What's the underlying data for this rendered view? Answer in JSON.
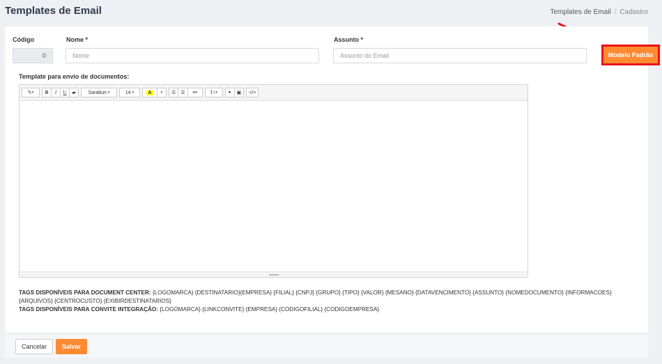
{
  "header": {
    "title": "Templates de Email",
    "breadcrumb": [
      "Templates de Email",
      "Cadastro"
    ]
  },
  "form": {
    "codigo_label": "Código",
    "codigo_value": "0",
    "nome_label": "Nome",
    "nome_placeholder": "Nome",
    "assunto_label": "Assunto",
    "assunto_placeholder": "Assunto do Email",
    "required_mark": "*",
    "modelo_button": "Modelo Padrão",
    "template_label": "Template para envio de documentos:"
  },
  "editor": {
    "font_name": "Sarabun",
    "font_size": "14"
  },
  "tags": {
    "document_center_title": "TAGS DISPONÍVEIS PARA DOCUMENT CENTER:",
    "document_center_values": "{LOGOMARCA} {DESTINATARIO}{EMPRESA} {FILIAL} {CNPJ} {GRUPO} {TIPO} {VALOR} {MESANO} {DATAVENCIMENTO} {ASSUNTO} {NOMEDOCUMENTO} {INFORMACOES} {ARQUIVOS} {CENTROCUSTO} {EXIBIRDESTINATARIOS}",
    "convite_title": "TAGS DISPONÍVEIS PARA CONVITE INTEGRAÇÃO:",
    "convite_values": "{LOGOMARCA} {LINKCONVITE} {EMPRESA} {CODIGOFILIAL} {CODIGOEMPRESA}"
  },
  "footer": {
    "cancel_label": "Cancelar",
    "save_label": "Salvar"
  },
  "colors": {
    "accent": "#ff8a30",
    "highlight_border": "#e8141a"
  }
}
